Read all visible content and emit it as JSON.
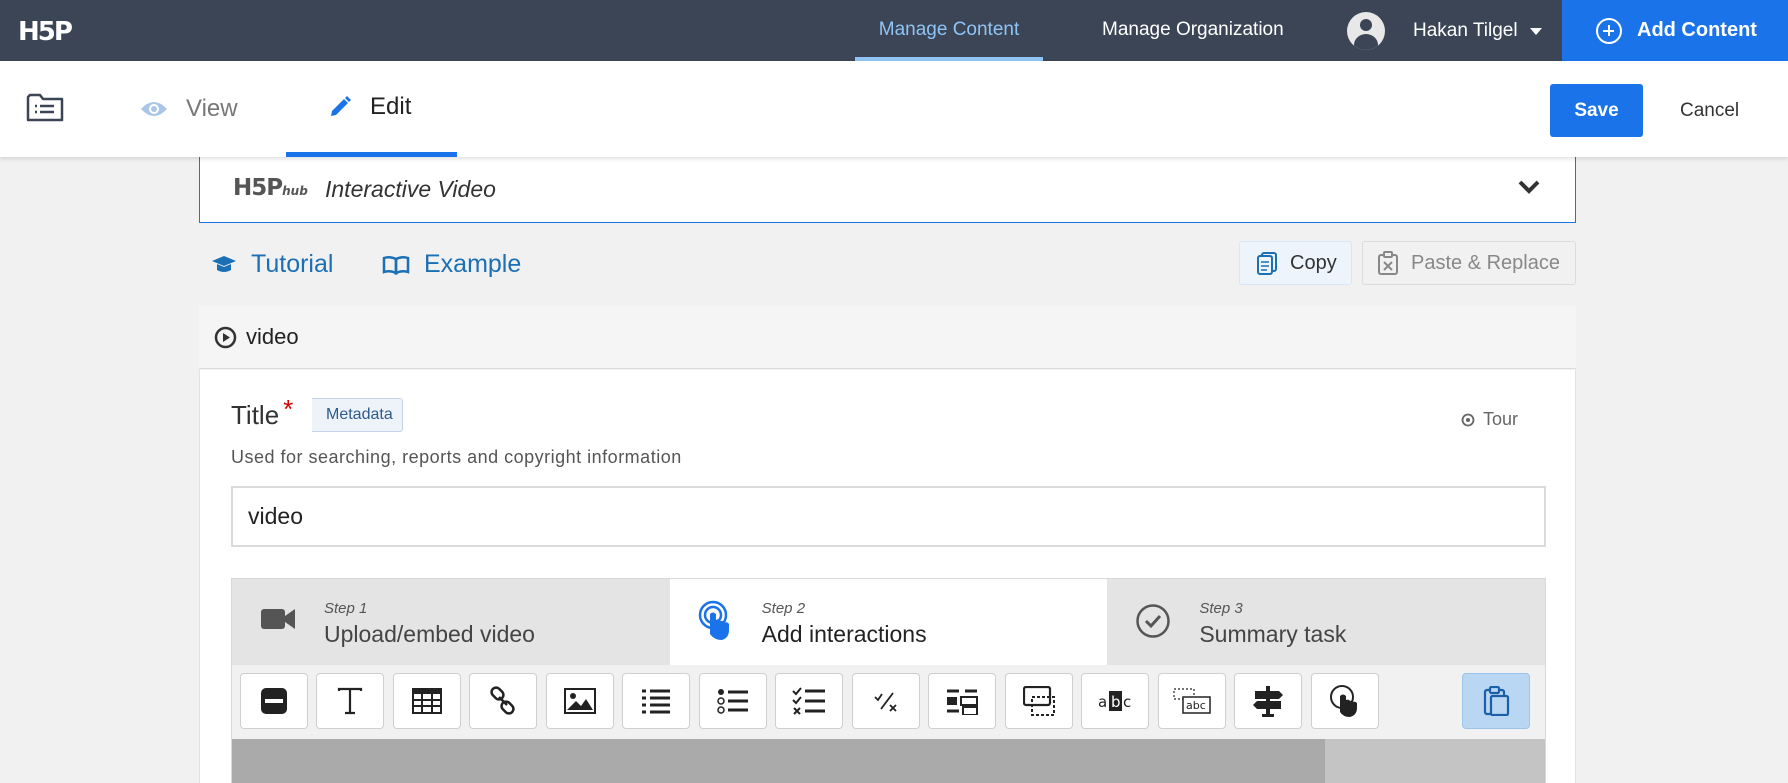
{
  "header": {
    "logo": "H5P",
    "nav": [
      {
        "label": "Manage Content",
        "active": true
      },
      {
        "label": "Manage Organization",
        "active": false
      }
    ],
    "user_name": "Hakan Tilgel",
    "add_content_label": "Add Content",
    "colors": {
      "bar": "#3b4555",
      "accent": "#1a73e8",
      "active_nav": "#8fc4f5"
    }
  },
  "subbar": {
    "view_label": "View",
    "edit_label": "Edit",
    "save_label": "Save",
    "cancel_label": "Cancel"
  },
  "hub": {
    "logo_text": "H5P",
    "logo_sub": "hub",
    "content_type": "Interactive Video"
  },
  "links": {
    "tutorial": "Tutorial",
    "example": "Example",
    "copy": "Copy",
    "paste_replace": "Paste & Replace"
  },
  "section": {
    "title": "video"
  },
  "title_field": {
    "label": "Title",
    "required_mark": "*",
    "metadata_label": "Metadata",
    "tour_label": "Tour",
    "help": "Used for searching, reports and copyright information",
    "value": "video"
  },
  "steps": [
    {
      "num": "Step 1",
      "label": "Upload/embed video",
      "icon": "video-camera-icon",
      "active": false
    },
    {
      "num": "Step 2",
      "label": "Add interactions",
      "icon": "touch-hand-icon",
      "active": true
    },
    {
      "num": "Step 3",
      "label": "Summary task",
      "icon": "check-circle-icon",
      "active": false
    }
  ],
  "toolbar_icons": [
    "label-icon",
    "text-icon",
    "table-icon",
    "link-icon",
    "image-icon",
    "statements-icon",
    "single-choice-icon",
    "multiple-choice-icon",
    "true-false-icon",
    "drag-text-icon",
    "crossroads-icon",
    "fill-blanks-icon",
    "drag-drop-icon",
    "navigation-hotspot-icon",
    "free-text-icon",
    "paste-icon"
  ]
}
